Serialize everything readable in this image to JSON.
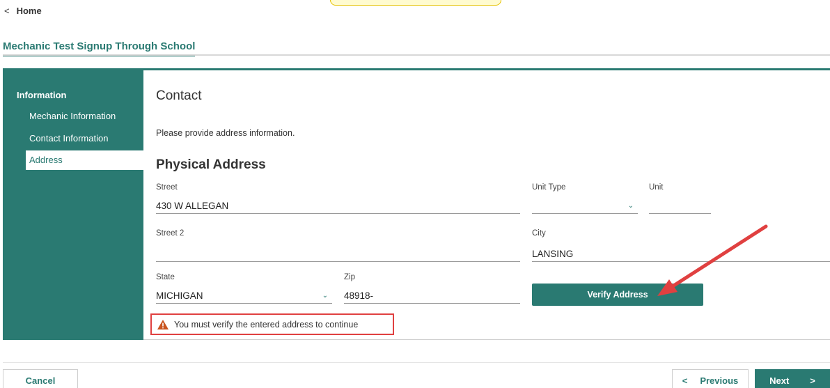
{
  "nav": {
    "home_label": "Home"
  },
  "page": {
    "title": "Mechanic Test Signup Through School"
  },
  "sidebar": {
    "section": "Information",
    "items": [
      {
        "label": "Mechanic Information",
        "active": false
      },
      {
        "label": "Contact Information",
        "active": false
      },
      {
        "label": "Address",
        "active": true
      }
    ]
  },
  "content": {
    "heading": "Contact",
    "intro": "Please provide address information.",
    "subheading": "Physical Address"
  },
  "form": {
    "street": {
      "label": "Street",
      "value": "430 W ALLEGAN"
    },
    "unit_type": {
      "label": "Unit Type",
      "value": ""
    },
    "unit": {
      "label": "Unit",
      "value": ""
    },
    "street2": {
      "label": "Street 2",
      "value": ""
    },
    "city": {
      "label": "City",
      "value": "LANSING"
    },
    "state": {
      "label": "State",
      "value": "MICHIGAN"
    },
    "zip": {
      "label": "Zip",
      "value": "48918-"
    }
  },
  "actions": {
    "verify_label": "Verify Address"
  },
  "warning": {
    "message": "You must verify the entered address to continue"
  },
  "footer": {
    "cancel_label": "Cancel",
    "previous_label": "Previous",
    "next_label": "Next"
  },
  "colors": {
    "accent": "#2a7a72",
    "warning_icon": "#c9541f",
    "annotation_red": "#e04040"
  },
  "icons": {
    "back": "chevron-left-icon",
    "dropdown": "chevron-down-icon",
    "warning": "warning-triangle-icon",
    "forward": "chevron-right-icon"
  }
}
